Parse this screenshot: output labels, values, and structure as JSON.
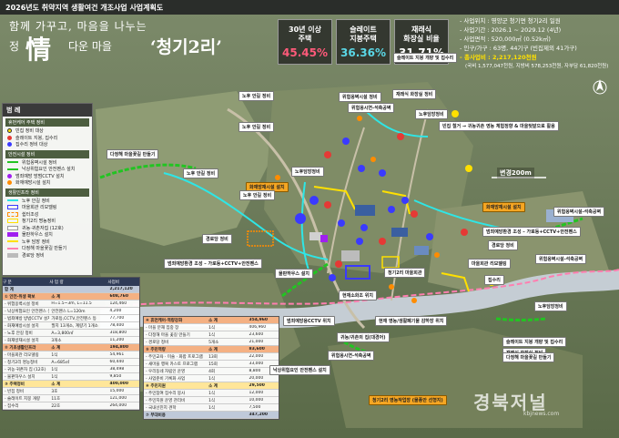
{
  "header": {
    "title": "2026년도 취약지역 생활여건 개조사업 사업계획도"
  },
  "slogan": {
    "line1": "함께 가꾸고, 마음을 나누는",
    "line2_prefix": "정",
    "line2_mid": "다운 마을",
    "han_char": "情",
    "village": "‘청기2리’"
  },
  "stats": [
    {
      "label": "30년 이상\n주택",
      "value": "45.45%"
    },
    {
      "label": "슬레이트\n지붕주택",
      "value": "36.36%"
    },
    {
      "label": "재래식\n화장실 비율",
      "value": "31.71%"
    }
  ],
  "info": {
    "lines": [
      "- 사업위치 : 영양군 청기면 청기2리 일원",
      "- 사업기간 : 2026.1 ~ 2029.12 (4년)",
      "- 사업면적 : 520,000㎡ (0.52k㎡)",
      "- 인구/가구 : 63명, 44기구 (빈집제외 41가구)"
    ],
    "total": "- 총사업비 : 2,217,120천원",
    "total_detail": "(국비 1,577,047천원, 지방비 578,253천원, 자부담 61,820천원)"
  },
  "legend": {
    "title": "범 례",
    "groups": [
      {
        "header": "휴먼케어 주택 정비",
        "items": [
          {
            "name": "빈집 정비 대상",
            "sym": "dot-yellow"
          },
          {
            "name": "슬레이트 지붕, 집수리",
            "sym": "dot-red"
          },
          {
            "name": "집수리 정비 대상",
            "sym": "dot-blue"
          }
        ]
      },
      {
        "header": "안전시설 정비",
        "items": [
          {
            "name": "위험옹벽시설 정비",
            "sym": "line-green"
          },
          {
            "name": "낙상위험요인 안전펜스 설치",
            "sym": "line-green2"
          },
          {
            "name": "범죄예방 방범CCTV 설치",
            "sym": "dot-purple"
          },
          {
            "name": "화재예방시설 설치",
            "sym": "dot-orange"
          }
        ]
      },
      {
        "header": "생활인프라 정비",
        "items": [
          {
            "name": "노후 안길 정비",
            "sym": "line-cyan"
          },
          {
            "name": "마을회관 리모델링",
            "sym": "box-blue"
          },
          {
            "name": "쉼터조성",
            "sym": "box-orange"
          },
          {
            "name": "청기2리 명농정비",
            "sym": "box-yellow"
          },
          {
            "name": "귀농·귀촌자집 (12호)",
            "sym": "box-white"
          },
          {
            "name": "물판하우스 설치",
            "sym": "box-purple"
          },
          {
            "name": "노후 담장 정비",
            "sym": "line-yellow"
          },
          {
            "name": "다정해 마을꽃길 만들기",
            "sym": "line-pink"
          },
          {
            "name": "경로당 정비",
            "sym": "box-gray"
          }
        ]
      }
    ]
  },
  "table_left": {
    "headers": [
      "구 분",
      "사 업 량",
      "사업비"
    ],
    "total": [
      "합 계",
      "",
      "2,217,120"
    ],
    "rows": [
      {
        "type": "orange",
        "cells": [
          "① 안전·위생 확보",
          "소 계",
          "608,760"
        ]
      },
      {
        "type": "",
        "cells": [
          "- 위험옹벽시설 정비",
          "H=1.5~3m, L=11.5",
          "124,460"
        ]
      },
      {
        "type": "",
        "cells": [
          "- 낙상위험요인 안전펜스 설치",
          "안전펜스 L=120m",
          "4,200"
        ]
      },
      {
        "type": "",
        "cells": [
          "- 범죄예방 방범CCTV 설치",
          "가로등,CCTV,안전펜스 등",
          "77,700"
        ]
      },
      {
        "type": "",
        "cells": [
          "- 화재예방시설 설치",
          "필지 13개소, 계량기 1개소",
          "78,400"
        ]
      },
      {
        "type": "",
        "cells": [
          "- 노후 안길 정비",
          "A=3,800㎡",
          "318,800"
        ]
      },
      {
        "type": "",
        "cells": [
          "- 화재방재시설 설치",
          "3개소",
          "11,200"
        ]
      },
      {
        "type": "orange",
        "cells": [
          "② 기초생활인프라",
          "소 계",
          "194,800"
        ]
      },
      {
        "type": "",
        "cells": [
          "- 마을회관 리모델링",
          "1식",
          "54,961"
        ]
      },
      {
        "type": "",
        "cells": [
          "- 청기2리 명농정비",
          "A=685㎡",
          "60,440"
        ]
      },
      {
        "type": "",
        "cells": [
          "- 귀농·귀촌자 집 (12호)",
          "1식",
          "38,498"
        ]
      },
      {
        "type": "",
        "cells": [
          "- 물판하우스 설치",
          "1식",
          "9,850"
        ]
      },
      {
        "type": "yellow",
        "cells": [
          "③ 주택정비",
          "소 계",
          "400,000"
        ]
      },
      {
        "type": "",
        "cells": [
          "- 빈집 정비",
          "3호",
          "15,000"
        ]
      },
      {
        "type": "",
        "cells": [
          "- 슬레이트 지붕 개량",
          "11호",
          "121,000"
        ]
      },
      {
        "type": "",
        "cells": [
          "- 집수리",
          "22호",
          "264,000"
        ]
      }
    ]
  },
  "table_right": {
    "headers": [
      "④ 휴먼케어·역량강화",
      "소 계",
      "354,960"
    ],
    "rows": [
      {
        "type": "",
        "cells": [
          "- 마을 분재 집중 장",
          "1식",
          "406,960"
        ]
      },
      {
        "type": "",
        "cells": [
          "- 다정해 마을 꽃길 만들기",
          "1식",
          "23,600"
        ]
      },
      {
        "type": "",
        "cells": [
          "- 경로당 정비",
          "5개소",
          "21,000"
        ]
      },
      {
        "type": "orange",
        "cells": [
          "⑤ 주민역량",
          "소 계",
          "83,600"
        ]
      },
      {
        "type": "",
        "cells": [
          "- 주민교육 · 미술 · 화합 프로그램",
          "13회",
          "22,000"
        ]
      },
      {
        "type": "",
        "cells": [
          "- 새마을 행복 카스토 프로그램",
          "15회",
          "33,000"
        ]
      },
      {
        "type": "",
        "cells": [
          "- 우리동네 자립인 운영",
          "4회",
          "8,800"
        ]
      },
      {
        "type": "",
        "cells": [
          "- 사업준비 기록화 사업",
          "1식",
          "20,000"
        ]
      },
      {
        "type": "yellow",
        "cells": [
          "⑥ 주민지원",
          "소 계",
          "29,500"
        ]
      },
      {
        "type": "",
        "cells": [
          "- 주민참여 집수리 봉사",
          "1식",
          "12,000"
        ]
      },
      {
        "type": "",
        "cells": [
          "- 주민지원 운영 관리비",
          "1식",
          "10,000"
        ]
      },
      {
        "type": "",
        "cells": [
          "- 국내선진지 견학",
          "1식",
          "7,500"
        ]
      },
      {
        "type": "sum",
        "cells": [
          "⑦ 부대비용",
          "",
          "347,200"
        ]
      }
    ]
  },
  "labels": [
    {
      "key": "l1",
      "text": "노후 안길 정비",
      "style": "white"
    },
    {
      "key": "l2",
      "text": "위험옹벽시설 정비",
      "style": "white"
    },
    {
      "key": "l3",
      "text": "슬레이트 지붕 개량 및 집수리",
      "style": "white"
    },
    {
      "key": "l4",
      "text": "재래식 화장실 정비",
      "style": "white"
    },
    {
      "key": "l5",
      "text": "위험옹시연-석축공벽",
      "style": "white"
    },
    {
      "key": "l6",
      "text": "노후담장정비",
      "style": "white"
    },
    {
      "key": "l7",
      "text": "빈집 철거 → 귀농귀촌 영농 체험정향 & 마을텃밭으로 활용",
      "style": "white"
    },
    {
      "key": "l8",
      "text": "다정해 마을꽃길 만들기",
      "style": "white"
    },
    {
      "key": "l9",
      "text": "노후 안길 정비",
      "style": "white"
    },
    {
      "key": "l10",
      "text": "노후 안길 정비",
      "style": "white"
    },
    {
      "key": "l11",
      "text": "노후담장정비",
      "style": "white"
    },
    {
      "key": "l12",
      "text": "화재방재시설 설치",
      "style": "orange"
    },
    {
      "key": "l13",
      "text": "화재방재시설 설치",
      "style": "orange"
    },
    {
      "key": "l14",
      "text": "노후 안길 정비",
      "style": "white"
    },
    {
      "key": "l15",
      "text": "위험옹벽시설-석축공벽",
      "style": "white"
    },
    {
      "key": "l16",
      "text": "범죄예방환경 조성 – 가로등+CCTV+안전펜스",
      "style": "white"
    },
    {
      "key": "l17",
      "text": "경로당 정비",
      "style": "white"
    },
    {
      "key": "l18",
      "text": "경로당 정비",
      "style": "white"
    },
    {
      "key": "l19",
      "text": "범죄예방환경 조성 – 가로등+CCTV+안전펜스",
      "style": "white"
    },
    {
      "key": "l20",
      "text": "위험옹벽시설-석축공벽",
      "style": "white"
    },
    {
      "key": "l21",
      "text": "물판하우스 설치",
      "style": "white"
    },
    {
      "key": "l22",
      "text": "마을회관 리모델링",
      "style": "white"
    },
    {
      "key": "l23",
      "text": "집수리",
      "style": "white"
    },
    {
      "key": "l24",
      "text": "노후담장정비",
      "style": "white"
    },
    {
      "key": "l25",
      "text": "현재소화조 위치",
      "style": "white"
    },
    {
      "key": "l26",
      "text": "범죄예방용CCTV 위치",
      "style": "white"
    },
    {
      "key": "l27",
      "text": "현재 영농/생활폐기물 감하장 위치",
      "style": "white"
    },
    {
      "key": "l28",
      "text": "슬레이트 지붕 개량 및 집수리",
      "style": "white"
    },
    {
      "key": "l29",
      "text": "재래식 화장실 정비",
      "style": "white"
    },
    {
      "key": "l30",
      "text": "귀농/귀촌의 집(대경어)",
      "style": "white"
    },
    {
      "key": "l31",
      "text": "위험옹시연-석축공벽",
      "style": "white"
    },
    {
      "key": "l32",
      "text": "다정해 마을꽃길 만들기",
      "style": "white"
    },
    {
      "key": "l33",
      "text": "낙상위험요인 안전펜스 설치",
      "style": "white"
    },
    {
      "key": "l34",
      "text": "청기2리 영농작업장 (물풍안 선형지)",
      "style": "orange"
    },
    {
      "key": "l35",
      "text": "청기2리 마을회관",
      "style": "white"
    }
  ],
  "map_text": {
    "scale": "변경200m",
    "watermark": "경북저널",
    "watermark_url": "kbjnews.com"
  }
}
